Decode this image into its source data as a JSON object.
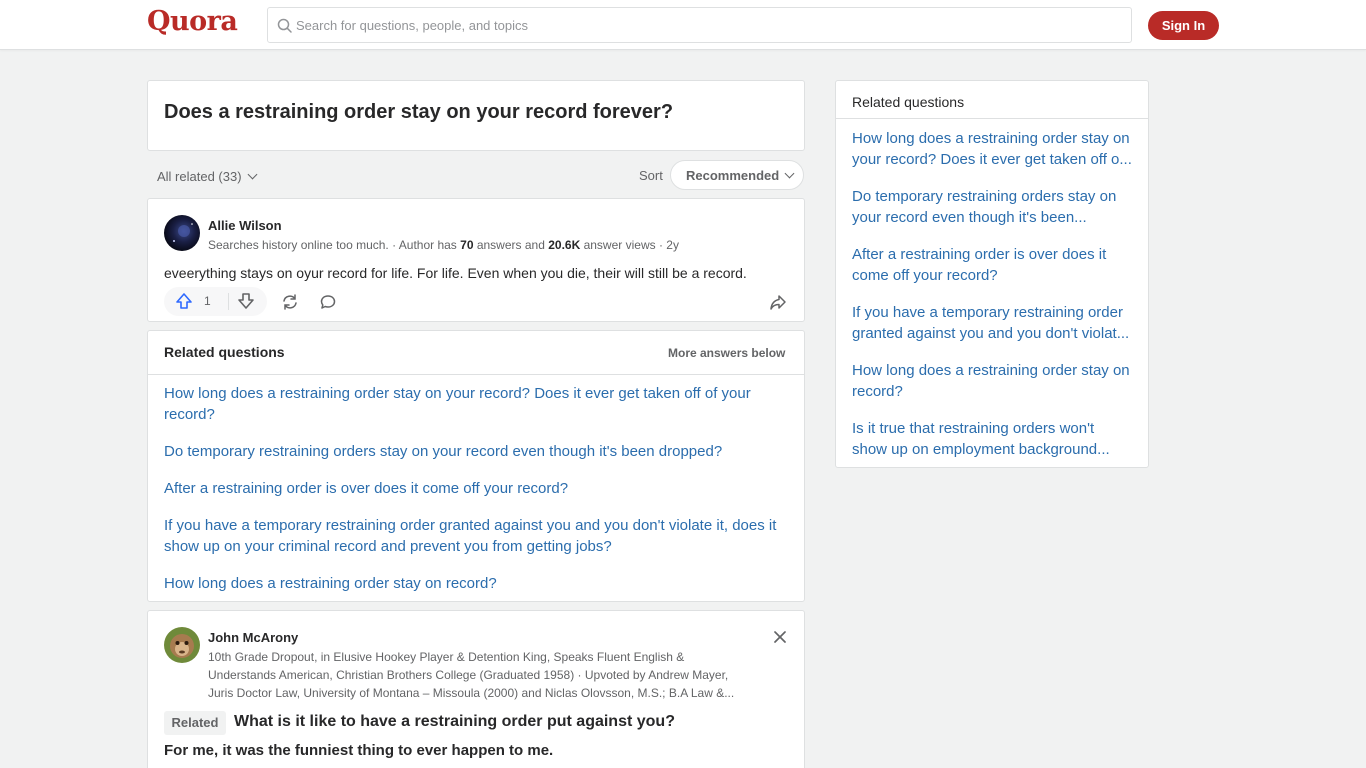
{
  "header": {
    "logo": "Quora",
    "search_placeholder": "Search for questions, people, and topics",
    "signin_label": "Sign In"
  },
  "question": {
    "title": "Does a restraining order stay on your record forever?"
  },
  "filter": {
    "all_related": "All related (33)",
    "sort_label": "Sort",
    "sort_value": "Recommended"
  },
  "answer1": {
    "author": "Allie Wilson",
    "cred_prefix": "Searches history online too much. · Author has ",
    "answers_count": "70",
    "cred_middle": " answers and ",
    "views_count": "20.6K",
    "cred_suffix": " answer views · 2y",
    "text": "eveerything stays on oyur record for life. For life. Even when you die, their will still be a record.",
    "upvotes": "1"
  },
  "related_main": {
    "heading": "Related questions",
    "more_below": "More answers below",
    "items": [
      "How long does a restraining order stay on your record? Does it ever get taken off of your record?",
      "Do temporary restraining orders stay on your record even though it's been dropped?",
      "After a restraining order is over does it come off your record?",
      "If you have a temporary restraining order granted against you and you don't violate it, does it show up on your criminal record and prevent you from getting jobs?",
      "How long does a restraining order stay on record?"
    ]
  },
  "answer2": {
    "author": "John McArony",
    "cred_line1": "10th Grade Dropout, in Elusive Hookey Player & Detention King, Speaks Fluent English &",
    "cred_line2": "Understands American, Christian Brothers College (Graduated 1958) · Upvoted by Andrew Mayer,",
    "cred_line3": "Juris Doctor Law, University of Montana – Missoula (2000) and Niclas Olovsson, M.S.; B.A Law &...",
    "related_badge": "Related",
    "related_title": "What is it like to have a restraining order put against you?",
    "answer_start": "For me, it was the funniest thing to ever happen to me."
  },
  "sidebar": {
    "heading": "Related questions",
    "items": [
      {
        "line1": "How long does a restraining order stay on",
        "line2": "your record? Does it ever get taken off o..."
      },
      {
        "line1": "Do temporary restraining orders stay on",
        "line2": "your record even though it's been..."
      },
      {
        "line1": "After a restraining order is over does it",
        "line2": "come off your record?"
      },
      {
        "line1": "If you have a temporary restraining order",
        "line2": "granted against you and you don't violat..."
      },
      {
        "line1": "How long does a restraining order stay on",
        "line2": "record?"
      },
      {
        "line1": "Is it true that restraining orders won't",
        "line2": "show up on employment background..."
      }
    ]
  },
  "colors": {
    "brand": "#b92b27",
    "link": "#2b6dad",
    "upvote": "#2e69ff"
  },
  "icons": [
    "search-icon",
    "upvote-icon",
    "downvote-icon",
    "share-icon",
    "comment-icon",
    "forward-icon",
    "chevron-down-icon",
    "close-icon"
  ]
}
